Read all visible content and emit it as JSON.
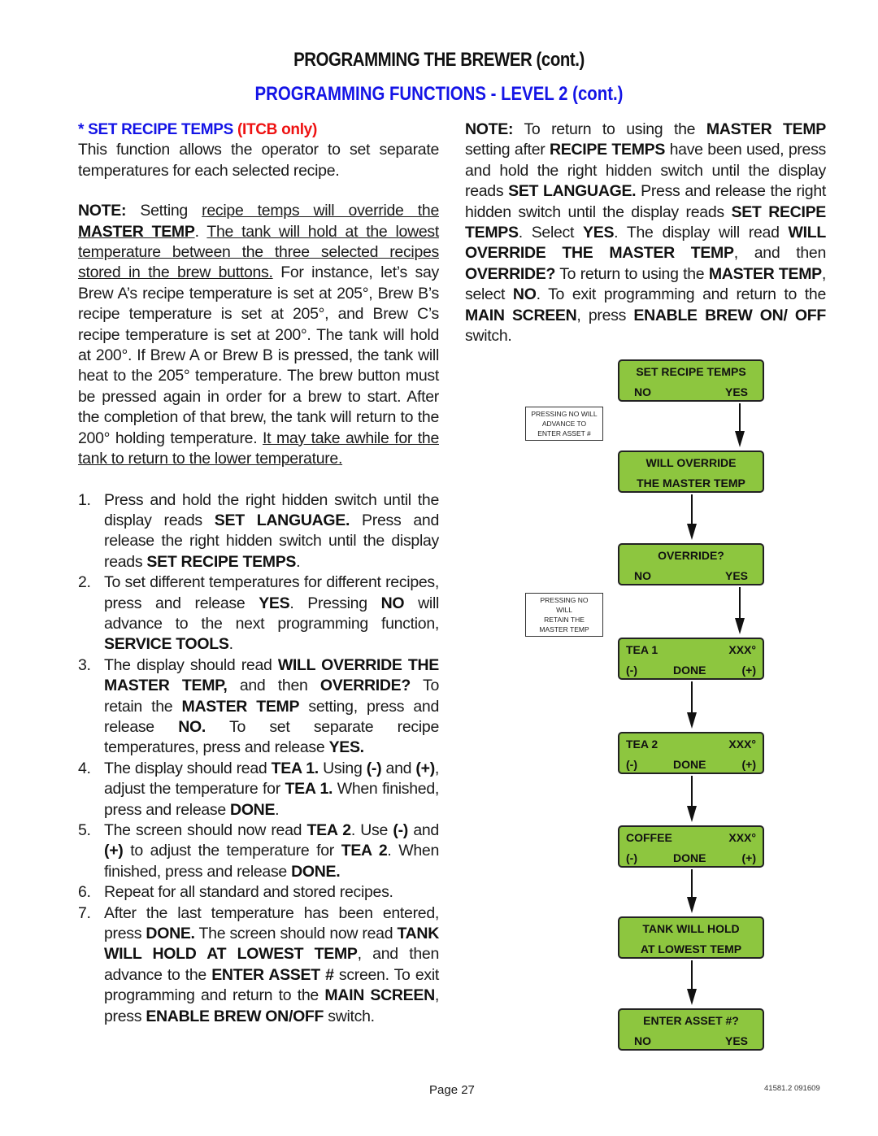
{
  "header": {
    "title": "PROGRAMMING THE BREWER (cont.)",
    "subtitle": "PROGRAMMING FUNCTIONS - LEVEL  2 (cont.)"
  },
  "section": {
    "bullet": "* SET RECIPE TEMPS ",
    "qualifier": "(ITCB only)",
    "intro": "This function allows the operator to set separate temperatures for each selected recipe."
  },
  "left_note": {
    "label": "NOTE:",
    "t1": " Setting ",
    "u1": "recipe temps will override the ",
    "u1b": "MASTER TEMP",
    "t2": ". ",
    "u2": "The tank will hold at the lowest temperature between the three selected recipes stored in the brew buttons.",
    "t3": " For instance, let’s say Brew A’s recipe temperature is set at 205°, Brew B’s recipe temperature is set at 205°, and Brew C’s recipe temperature is set at 200°. The tank will hold at 200°. If Brew A or Brew B is pressed, the tank will heat to the 205° temperature. The brew button must be pressed again in order for a brew to start. After the completion of that brew, the tank will return to the 200° holding temperature. ",
    "u3": "It may take awhile for the tank to return to the lower temperature."
  },
  "steps": [
    {
      "num": "1.",
      "parts": [
        {
          "t": "Press and hold the right hidden switch until the display reads "
        },
        {
          "b": "SET LANGUAGE."
        },
        {
          "t": " Press and release the right hidden switch until the display reads "
        },
        {
          "b": "SET RECIPE TEMPS"
        },
        {
          "t": "."
        }
      ]
    },
    {
      "num": "2.",
      "parts": [
        {
          "t": "To set different temperatures for different recipes, press and release "
        },
        {
          "b": "YES"
        },
        {
          "t": ". Pressing "
        },
        {
          "b": "NO"
        },
        {
          "t": " will advance to the next programming function, "
        },
        {
          "b": "SERVICE TOOLS"
        },
        {
          "t": "."
        }
      ]
    },
    {
      "num": "3.",
      "parts": [
        {
          "t": "The display should read "
        },
        {
          "b": "WILL OVERRIDE THE MASTER TEMP,"
        },
        {
          "t": " and then "
        },
        {
          "b": "OVERRIDE?"
        },
        {
          "t": " To retain the "
        },
        {
          "b": "MASTER TEMP"
        },
        {
          "t": " setting, press and release "
        },
        {
          "b": "NO."
        },
        {
          "t": "  To set separate recipe temperatures, press and release "
        },
        {
          "b": "YES."
        }
      ]
    },
    {
      "num": "4.",
      "parts": [
        {
          "t": "The display should read "
        },
        {
          "b": "TEA 1."
        },
        {
          "t": " Using "
        },
        {
          "b": "(-)"
        },
        {
          "t": " and "
        },
        {
          "b": "(+)"
        },
        {
          "t": ", adjust the temperature for "
        },
        {
          "b": "TEA 1."
        },
        {
          "t": " When finished, press and release "
        },
        {
          "b": "DONE"
        },
        {
          "t": "."
        }
      ]
    },
    {
      "num": "5.",
      "parts": [
        {
          "t": "The screen should now read "
        },
        {
          "b": "TEA 2"
        },
        {
          "t": ". Use "
        },
        {
          "b": "(-)"
        },
        {
          "t": " and "
        },
        {
          "b": "(+)"
        },
        {
          "t": " to adjust the temperature for "
        },
        {
          "b": "TEA 2"
        },
        {
          "t": ". When finished, press and release "
        },
        {
          "b": "DONE."
        }
      ]
    },
    {
      "num": "6.",
      "parts": [
        {
          "t": "Repeat for all standard and stored recipes."
        }
      ]
    },
    {
      "num": "7.",
      "parts": [
        {
          "t": "After the last temperature has been entered, press "
        },
        {
          "b": "DONE."
        },
        {
          "t": " The screen should now read "
        },
        {
          "b": "TANK WILL HOLD AT LOWEST TEMP"
        },
        {
          "t": ", and then advance to the "
        },
        {
          "b": "ENTER ASSET #"
        },
        {
          "t": " screen. To exit programming and return to the "
        },
        {
          "b": "MAIN SCREEN"
        },
        {
          "t": ", press "
        },
        {
          "b": "ENABLE BREW ON/OFF"
        },
        {
          "t": " switch."
        }
      ]
    }
  ],
  "right_note": {
    "parts": [
      {
        "b": "NOTE:"
      },
      {
        "t": "  To return to using the "
      },
      {
        "b": "MASTER TEMP"
      },
      {
        "t": " setting after "
      },
      {
        "b": "RECIPE TEMPS"
      },
      {
        "t": " have been used, press and hold the right hidden switch until the display reads "
      },
      {
        "b": "SET LANGUAGE."
      },
      {
        "t": " Press and release the right hidden switch until the display reads "
      },
      {
        "b": "SET RECIPE TEMPS"
      },
      {
        "t": ". Select "
      },
      {
        "b": "YES"
      },
      {
        "t": ". The display will read "
      },
      {
        "b": "WILL OVERRIDE THE MASTER TEMP"
      },
      {
        "t": ", and then "
      },
      {
        "b": "OVERRIDE?"
      },
      {
        "t": " To return to using the "
      },
      {
        "b": "MASTER TEMP"
      },
      {
        "t": ", select "
      },
      {
        "b": "NO"
      },
      {
        "t": ". To exit programming and return to the "
      },
      {
        "b": "MAIN SCREEN"
      },
      {
        "t": ", press "
      },
      {
        "b": "ENABLE BREW ON/ OFF"
      },
      {
        "t": " switch."
      }
    ]
  },
  "flow": {
    "lcd_color": "#8dc63f",
    "screens": [
      {
        "id": "set-recipe-temps",
        "r1": [
          "SET RECIPE TEMPS"
        ],
        "r2": [
          "NO",
          "YES"
        ]
      },
      {
        "id": "will-override",
        "r1": [
          "WILL OVERRIDE"
        ],
        "r2": [
          "THE MASTER TEMP"
        ]
      },
      {
        "id": "override",
        "r1": [
          "OVERRIDE?"
        ],
        "r2": [
          "NO",
          "YES"
        ]
      },
      {
        "id": "tea-1",
        "r1": [
          "TEA 1",
          "XXX°"
        ],
        "r2": [
          "(-)",
          "DONE",
          "(+)"
        ]
      },
      {
        "id": "tea-2",
        "r1": [
          "TEA 2",
          "XXX°"
        ],
        "r2": [
          "(-)",
          "DONE",
          "(+)"
        ]
      },
      {
        "id": "coffee",
        "r1": [
          "COFFEE",
          "XXX°"
        ],
        "r2": [
          "(-)",
          "DONE",
          "(+)"
        ]
      },
      {
        "id": "tank-will-hold",
        "r1": [
          "TANK WILL HOLD"
        ],
        "r2": [
          "AT LOWEST TEMP"
        ]
      },
      {
        "id": "enter-asset",
        "r1": [
          "ENTER ASSET #?"
        ],
        "r2": [
          "NO",
          "YES"
        ]
      }
    ],
    "side_notes": [
      {
        "lines": [
          "PRESSING NO WILL",
          "ADVANCE TO",
          "ENTER ASSET #"
        ]
      },
      {
        "lines": [
          "PRESSING NO",
          "WILL",
          "RETAIN THE",
          "MASTER TEMP"
        ]
      }
    ]
  },
  "footer": {
    "page": "Page 27",
    "doc_number": "41581.2 091609"
  }
}
